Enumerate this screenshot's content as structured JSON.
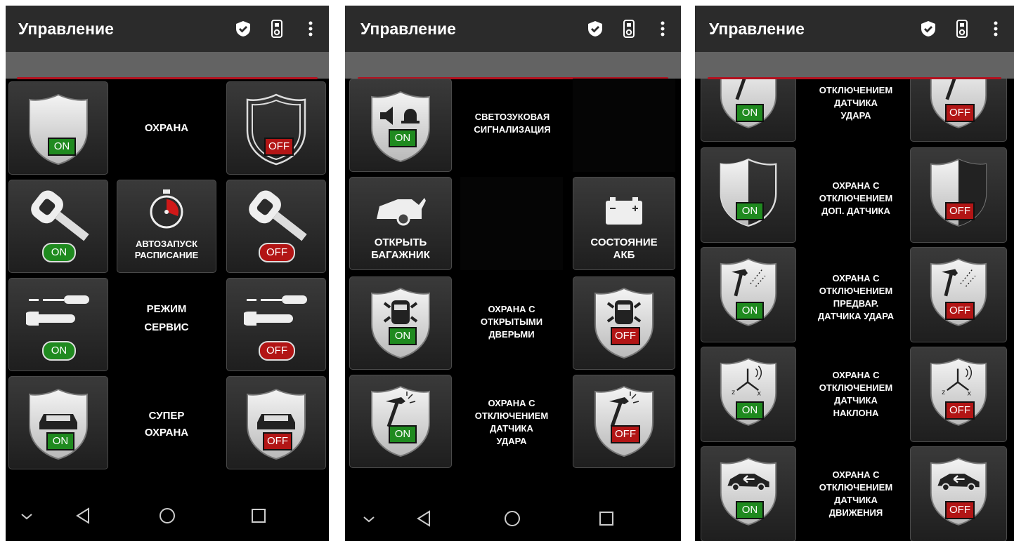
{
  "app": {
    "title": "Управление",
    "on": "ON",
    "off": "OFF"
  },
  "screen1": {
    "guard": "ОХРАНА",
    "autostart": [
      "АВТОЗАПУСК",
      "РАСПИСАНИЕ"
    ],
    "service": [
      "РЕЖИМ",
      "СЕРВИС"
    ],
    "super": [
      "СУПЕР",
      "ОХРАНА"
    ]
  },
  "screen2": {
    "siren": [
      "СВЕТОЗУКОВАЯ",
      "СИГНАЛИЗАЦИЯ"
    ],
    "trunk": [
      "ОТКРЫТЬ",
      "БАГАЖНИК"
    ],
    "battery": [
      "СОСТОЯНИЕ",
      "АКБ"
    ],
    "doors": [
      "ОХРАНА С",
      "ОТКРЫТЫМИ",
      "ДВЕРЬМИ"
    ],
    "shock": [
      "ОХРАНА С",
      "ОТКЛЮЧЕНИЕМ",
      "ДАТЧИКА",
      "УДАРА"
    ]
  },
  "screen3": {
    "shock_partial": [
      "ОТКЛЮЧЕНИЕМ",
      "ДАТЧИКА",
      "УДАРА"
    ],
    "extra": [
      "ОХРАНА С",
      "ОТКЛЮЧЕНИЕМ",
      "ДОП. ДАТЧИКА"
    ],
    "pre_shock": [
      "ОХРАНА С",
      "ОТКЛЮЧЕНИЕМ",
      "ПРЕДВАР.",
      "ДАТЧИКА УДАРА"
    ],
    "tilt": [
      "ОХРАНА С",
      "ОТКЛЮЧЕНИЕМ",
      "ДАТЧИКА",
      "НАКЛОНА"
    ],
    "motion": [
      "ОХРАНА С",
      "ОТКЛЮЧЕНИЕМ",
      "ДАТЧИКА",
      "ДВИЖЕНИЯ"
    ]
  },
  "colors": {
    "on": "#1f8a1f",
    "off": "#b21515",
    "accent": "#b3101e",
    "bar": "#2b2b2b"
  },
  "icons": {
    "appbar": [
      "shield-check-icon",
      "remote-key-icon",
      "overflow-menu-icon"
    ],
    "nav": [
      "chevron-down-icon",
      "back-icon",
      "home-icon",
      "recents-icon"
    ]
  }
}
